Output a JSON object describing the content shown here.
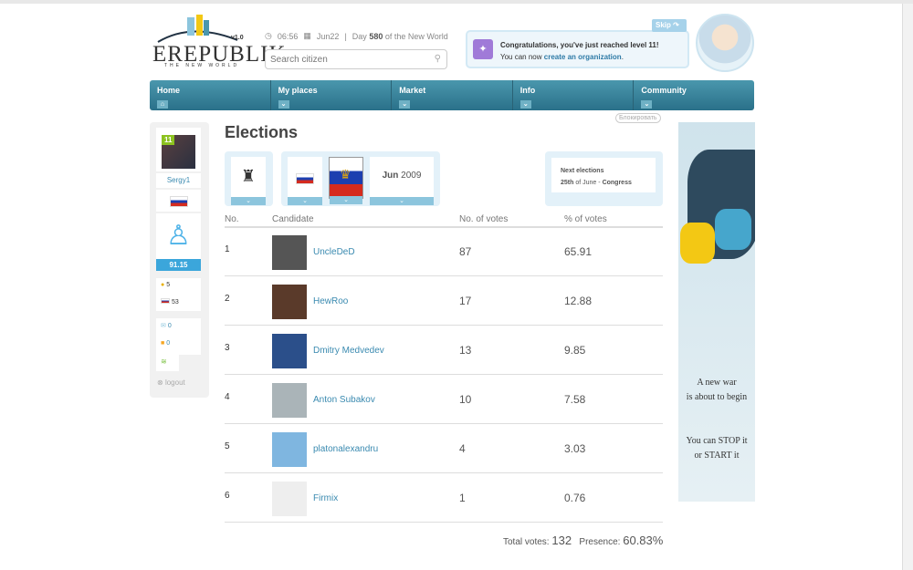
{
  "header": {
    "logo": "EREPUBLIK",
    "version": "v1.0",
    "tagline": "THE NEW WORLD",
    "time": "06:56",
    "date": "Jun22",
    "day_prefix": "Day",
    "day": "580",
    "day_suffix": "of the New World",
    "search_placeholder": "Search citizen"
  },
  "notification": {
    "skip": "Skip",
    "title": "Congratulations, you've just reached level 11!",
    "text": "You can now",
    "link": "create an organization",
    "end": "."
  },
  "nav": [
    {
      "label": "Home"
    },
    {
      "label": "My places"
    },
    {
      "label": "Market"
    },
    {
      "label": "Info"
    },
    {
      "label": "Community"
    }
  ],
  "block_label": "Блокировать",
  "sidebar": {
    "level": "11",
    "name": "Sergy1",
    "wellness": "91.15",
    "gold": "5",
    "currency": "53",
    "messages": "0",
    "alerts": "0",
    "logout": "logout"
  },
  "page": {
    "title": "Elections",
    "month": "Jun",
    "year": "2009",
    "next_title": "Next elections",
    "next_day": "25th",
    "next_of": "of June -",
    "next_type": "Congress"
  },
  "table": {
    "headers": [
      "No.",
      "Candidate",
      "No. of votes",
      "% of votes"
    ],
    "rows": [
      {
        "no": "1",
        "name": "UncleDeD",
        "votes": "87",
        "pct": "65.91",
        "color": "#555"
      },
      {
        "no": "2",
        "name": "HewRoo",
        "votes": "17",
        "pct": "12.88",
        "color": "#5a3a2a"
      },
      {
        "no": "3",
        "name": "Dmitry Medvedev",
        "votes": "13",
        "pct": "9.85",
        "color": "#2b4f8a"
      },
      {
        "no": "4",
        "name": "Anton Subakov",
        "votes": "10",
        "pct": "7.58",
        "color": "#aab4b8"
      },
      {
        "no": "5",
        "name": "platonalexandru",
        "votes": "4",
        "pct": "3.03",
        "color": "#7fb6e0"
      },
      {
        "no": "6",
        "name": "Firmix",
        "votes": "1",
        "pct": "0.76",
        "color": "#eee"
      }
    ]
  },
  "totals": {
    "votes_label": "Total votes:",
    "votes": "132",
    "presence_label": "Presence:",
    "presence": "60.83%"
  },
  "ad": {
    "line1": "A new war",
    "line2": "is about to begin",
    "line3": "You can STOP it",
    "line4": "or START it"
  }
}
